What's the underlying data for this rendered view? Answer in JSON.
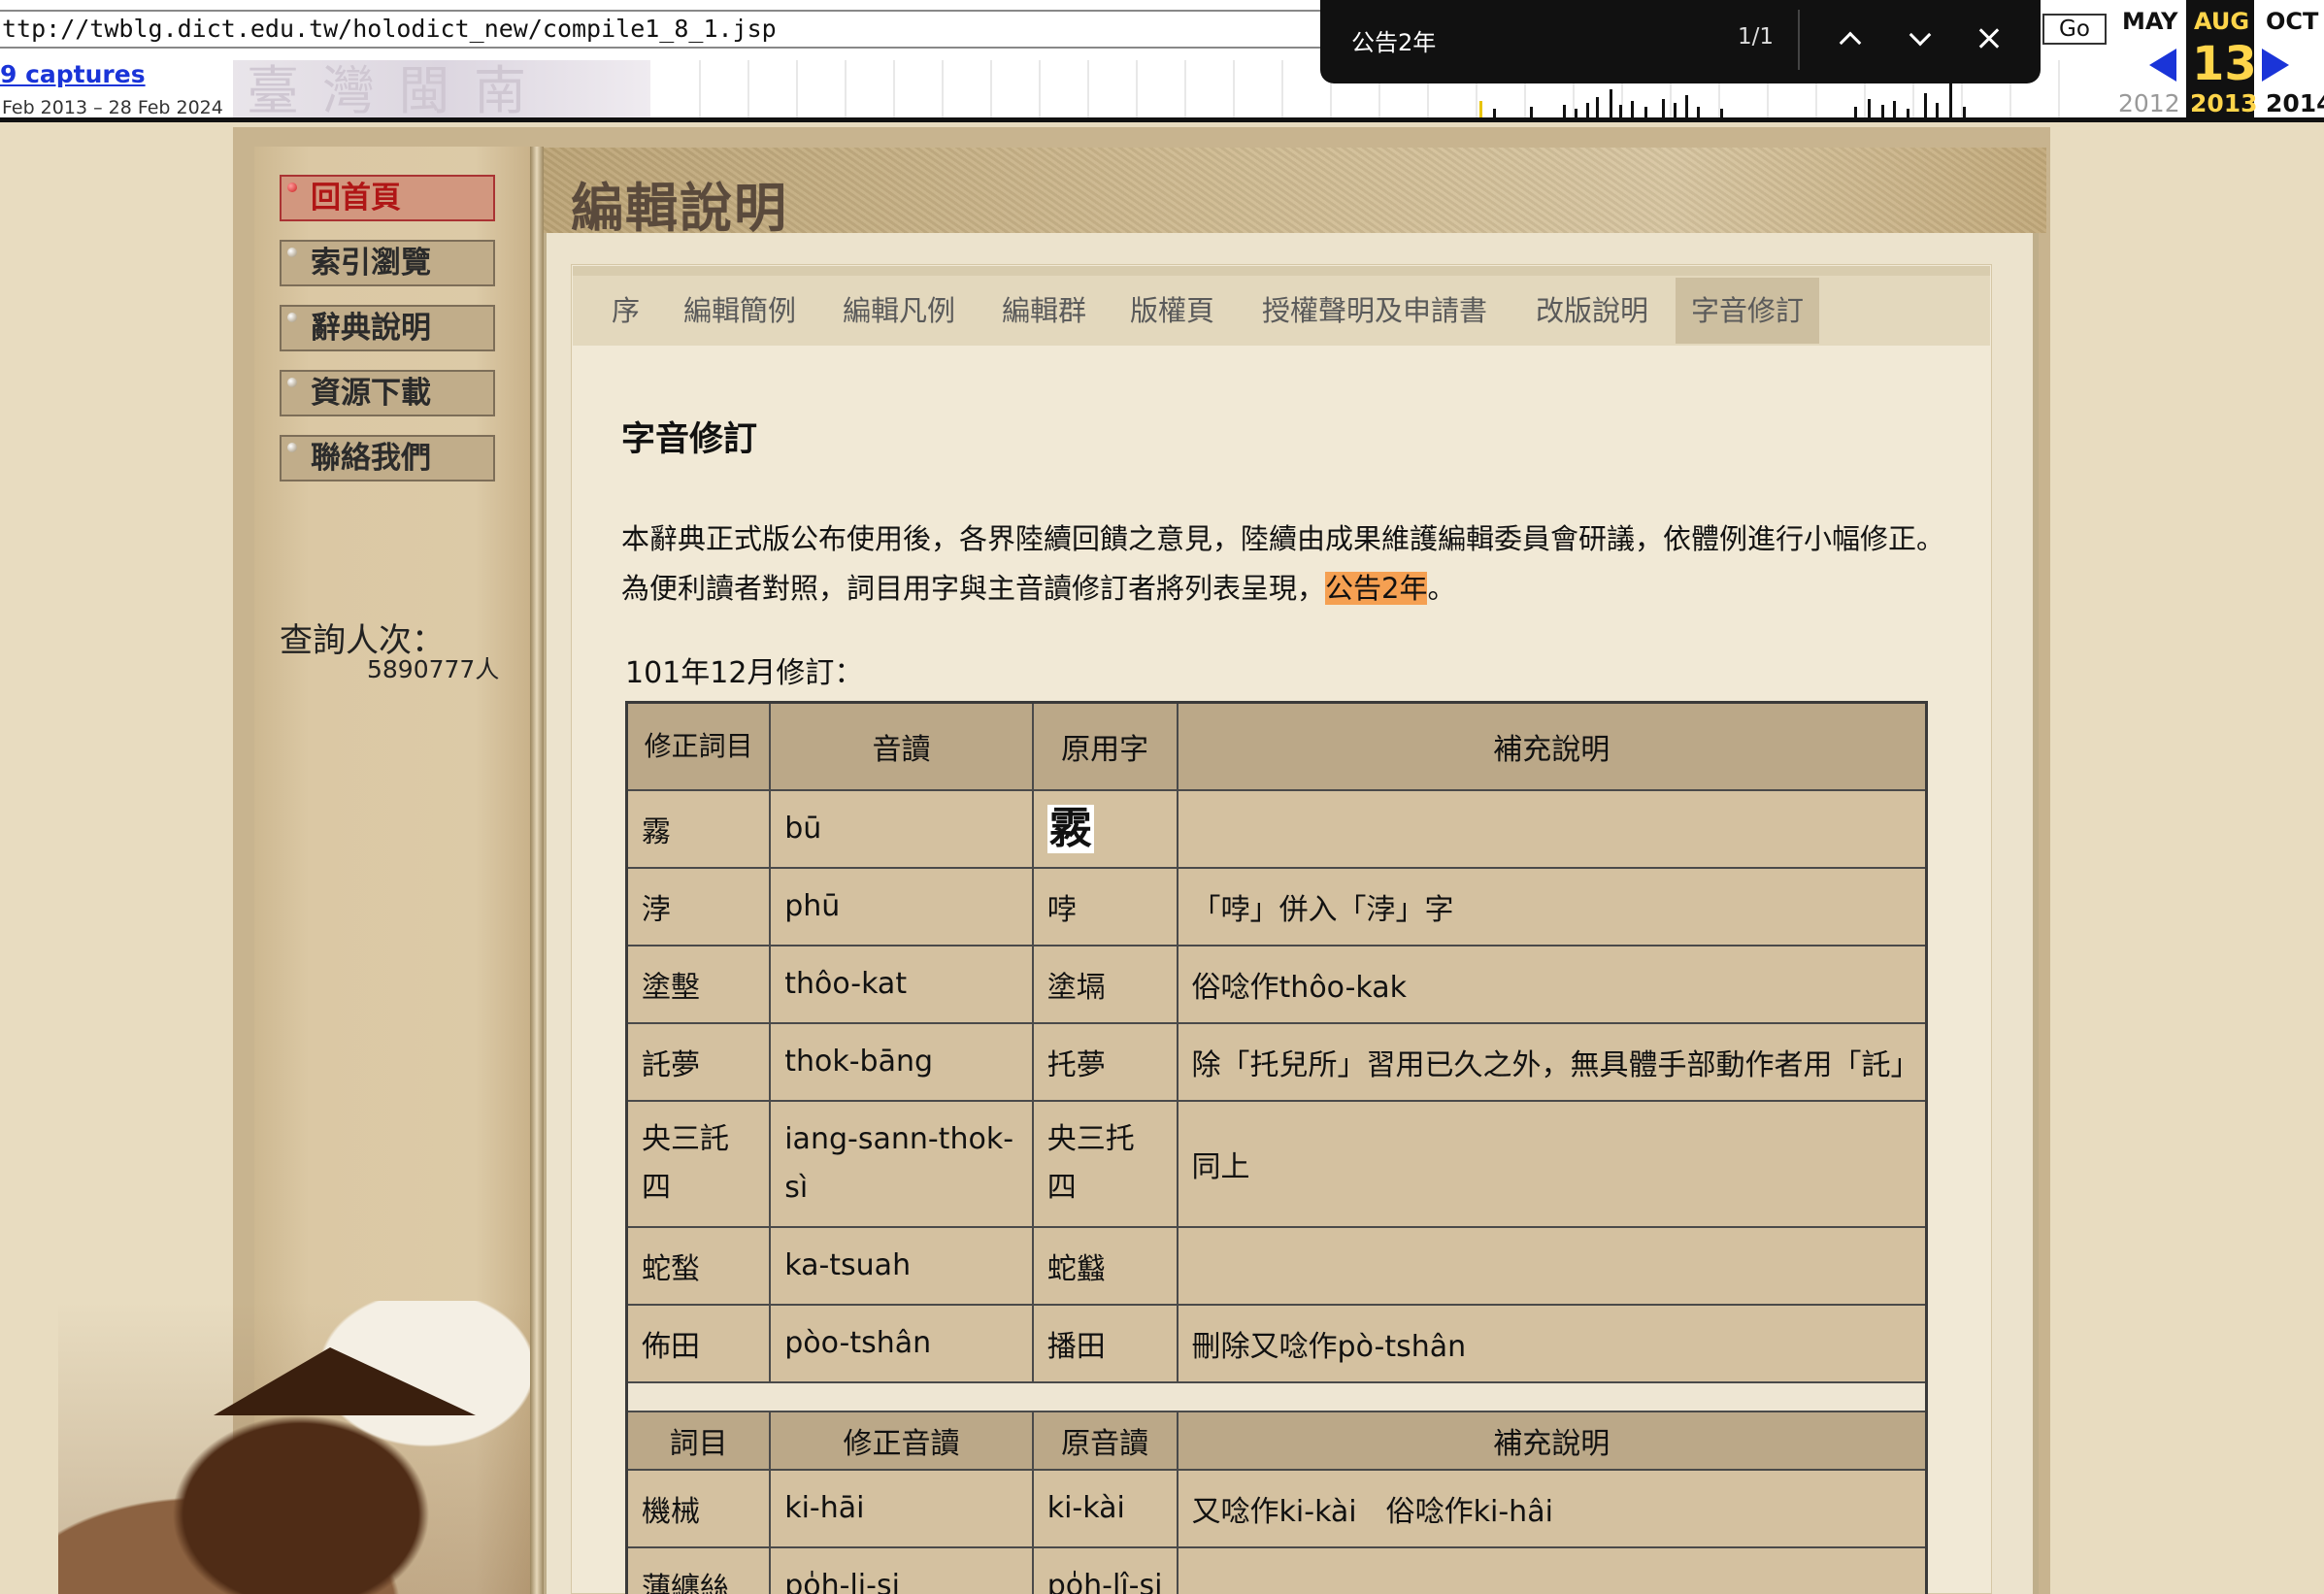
{
  "wayback": {
    "url": "ttp://twblg.dict.edu.tw/holodict_new/compile1_8_1.jsp",
    "captures": "9 captures",
    "range": "Feb 2013 – 28 Feb 2024",
    "banner_text": "臺灣閩南",
    "go": "Go",
    "prev_month": "MAY",
    "cur_month": "AUG",
    "next_month": "OCT",
    "day": "13",
    "prev_year": "2012",
    "cur_year": "2013",
    "next_year": "2014"
  },
  "find": {
    "query": "公告2年",
    "count": "1/1"
  },
  "sidebar": {
    "items": [
      {
        "label": "回首頁",
        "active": true
      },
      {
        "label": "索引瀏覽"
      },
      {
        "label": "辭典說明"
      },
      {
        "label": "資源下載"
      },
      {
        "label": "聯絡我們"
      }
    ],
    "visit_label": "查詢人次：",
    "visit_count": "5890777人"
  },
  "header": {
    "title": "編輯說明"
  },
  "tabs": [
    {
      "label": "序"
    },
    {
      "label": "編輯簡例"
    },
    {
      "label": "編輯凡例"
    },
    {
      "label": "編輯群"
    },
    {
      "label": "版權頁"
    },
    {
      "label": "授權聲明及申請書"
    },
    {
      "label": "改版說明"
    },
    {
      "label": "字音修訂",
      "active": true
    }
  ],
  "content": {
    "title": "字音修訂",
    "intro_pre": "本辭典正式版公布使用後，各界陸續回饋之意見，陸續由成果維護編輯委員會研議，依體例進行小幅修正。為便利讀者對照，詞目用字與主音讀修訂者將列表呈現，",
    "intro_hl": "公告2年",
    "intro_post": "。",
    "rev_label": "101年12月修訂："
  },
  "table1": {
    "headers": [
      "修正詞目",
      "音讀",
      "原用字",
      "補充說明"
    ],
    "rows": [
      {
        "word": "霧",
        "reading": "bū",
        "orig": "霚",
        "note": ""
      },
      {
        "word": "浡",
        "reading": "phū",
        "orig": "哱",
        "note": "「哱」併入「浡」字"
      },
      {
        "word": "塗墼",
        "reading": "thôo-kat",
        "orig": "塗塥",
        "note": "俗唸作thôo-kak"
      },
      {
        "word": "託夢",
        "reading": "thok-bāng",
        "orig": "托夢",
        "note": "除「托兒所」習用已久之外，無具體手部動作者用「託」"
      },
      {
        "word": "央三託四",
        "reading": "iang-sann-thok-sì",
        "orig": "央三托四",
        "note": "同上"
      },
      {
        "word": "蛇蝵",
        "reading": "ka-tsuah",
        "orig": "蛇蠽",
        "note": ""
      },
      {
        "word": "佈田",
        "reading": "pòo-tshân",
        "orig": "播田",
        "note": "刪除又唸作pò-tshân"
      }
    ]
  },
  "table2": {
    "headers": [
      "詞目",
      "修正音讀",
      "原音讀",
      "補充說明"
    ],
    "rows": [
      {
        "word": "機械",
        "reading": "ki-hāi",
        "orig": "ki-kài",
        "note": "又唸作ki-kài　俗唸作ki-hâi"
      },
      {
        "word": "薄纏絲",
        "reading": "po̍h-li-si",
        "orig": "po̍h-lî-si",
        "note": ""
      }
    ]
  }
}
